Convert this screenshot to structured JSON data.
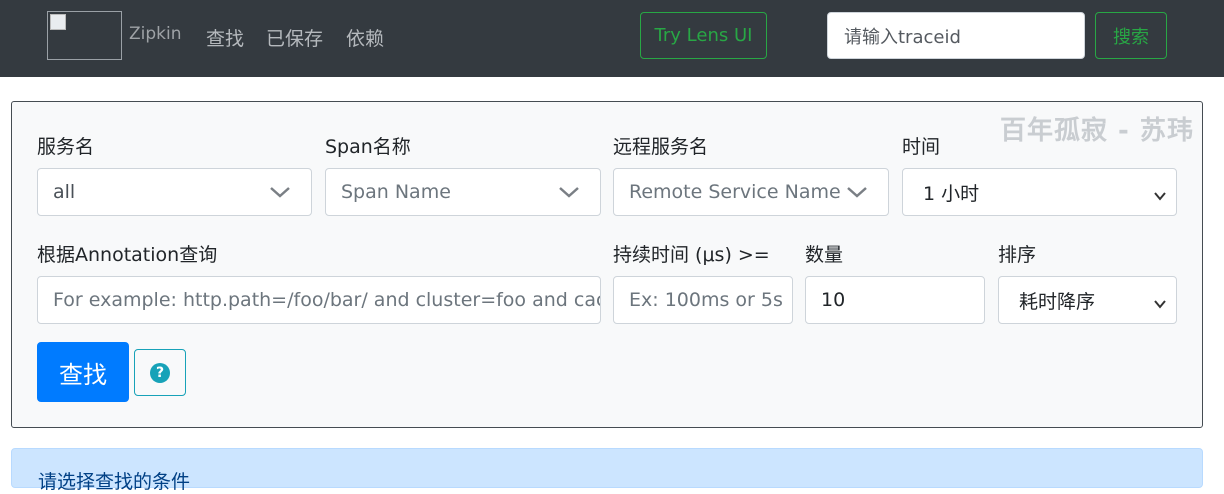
{
  "navbar": {
    "brand": "Zipkin",
    "links": {
      "find": "查找",
      "saved": "已保存",
      "dependencies": "依赖"
    },
    "lens_button": "Try Lens UI",
    "traceid_placeholder": "请输入traceid",
    "search_button": "搜索"
  },
  "watermark": "百年孤寂 - 苏玮",
  "form": {
    "service": {
      "label": "服务名",
      "value": "all"
    },
    "span": {
      "label": "Span名称",
      "placeholder": "Span Name"
    },
    "remote": {
      "label": "远程服务名",
      "placeholder": "Remote Service Name"
    },
    "time": {
      "label": "时间",
      "value": "1 小时"
    },
    "annotation": {
      "label": "根据Annotation查询",
      "placeholder": "For example: http.path=/foo/bar/ and cluster=foo and cache.miss"
    },
    "duration": {
      "label": "持续时间 (μs) >=",
      "placeholder": "Ex: 100ms or 5s"
    },
    "limit": {
      "label": "数量",
      "value": "10"
    },
    "sort": {
      "label": "排序",
      "value": "耗时降序"
    },
    "find_button": "查找",
    "help_button": "?"
  },
  "alert": {
    "text": "请选择查找的条件"
  },
  "colors": {
    "navbar": "#343a40",
    "primary": "#007bff",
    "success": "#28a745",
    "info": "#17a2b8"
  }
}
